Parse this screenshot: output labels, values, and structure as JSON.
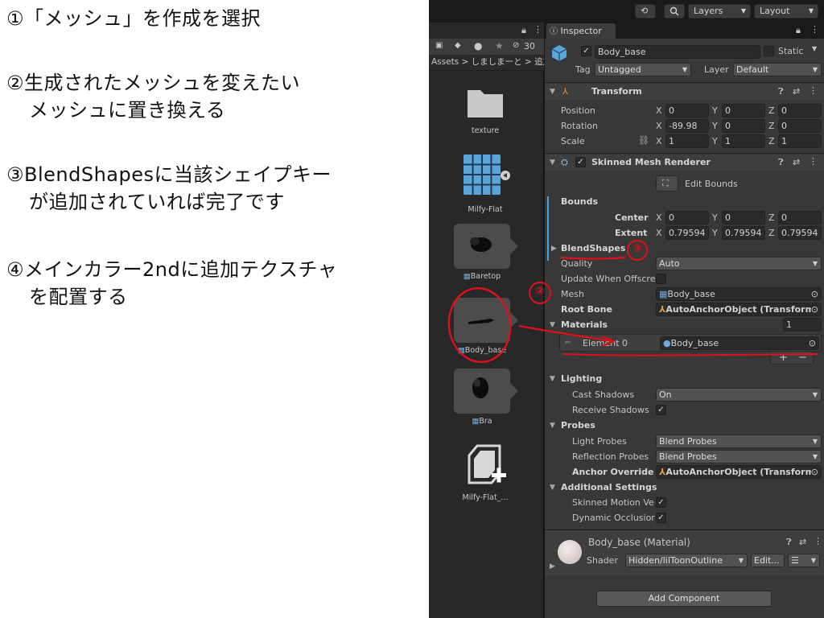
{
  "slide": {
    "steps": [
      {
        "line1": "①「メッシュ」を作成を選択",
        "line2": ""
      },
      {
        "line1": "②生成されたメッシュを変えたい",
        "line2": "メッシュに置き換える"
      },
      {
        "line1": "③BlendShapesに当該シェイプキー",
        "line2": "が追加されていれば完了です"
      },
      {
        "line1": "④メインカラー2ndに追加テクスチャ",
        "line2": "を配置する"
      }
    ]
  },
  "toolbar": {
    "history_icon": "history-icon",
    "search_icon": "search-icon",
    "layers_label": "Layers",
    "layout_label": "Layout"
  },
  "project": {
    "hidden_count": "30",
    "breadcrumb": "Assets > しましまーと > 追加",
    "assets": [
      {
        "label": "texture",
        "icon": "folder-icon"
      },
      {
        "label": "Milfy-Flat",
        "icon": "prefab-grid-icon"
      },
      {
        "label": "Baretop",
        "icon": "mesh-icon"
      },
      {
        "label": "Body_base",
        "icon": "mesh-icon"
      },
      {
        "label": "Bra",
        "icon": "mesh-icon"
      },
      {
        "label": "Milfy-Flat_...",
        "icon": "prefab-variant-icon"
      }
    ]
  },
  "inspector": {
    "tab_label": "Inspector",
    "object_name": "Body_base",
    "static_label": "Static",
    "tag_label": "Tag",
    "tag_value": "Untagged",
    "layer_label": "Layer",
    "layer_value": "Default",
    "transform": {
      "title": "Transform",
      "position_label": "Position",
      "rotation_label": "Rotation",
      "scale_label": "Scale",
      "position": {
        "x": "0",
        "y": "0",
        "z": "0"
      },
      "rotation": {
        "x": "-89.98",
        "y": "0",
        "z": "0"
      },
      "scale": {
        "x": "1",
        "y": "1",
        "z": "1"
      }
    },
    "smr": {
      "title": "Skinned Mesh Renderer",
      "edit_bounds": "Edit Bounds",
      "bounds_label": "Bounds",
      "center_label": "Center",
      "extent_label": "Extent",
      "center": {
        "x": "0",
        "y": "0",
        "z": "0"
      },
      "extent": {
        "x": "0.79594",
        "y": "0.79594",
        "z": "0.79594"
      },
      "blendshapes_label": "BlendShapes",
      "quality_label": "Quality",
      "quality_value": "Auto",
      "update_offscreen_label": "Update When Offscre",
      "mesh_label": "Mesh",
      "mesh_value": "Body_base",
      "root_bone_label": "Root Bone",
      "root_bone_value": "AutoAnchorObject (Transform",
      "materials_label": "Materials",
      "materials_count": "1",
      "element0_label": "Element 0",
      "element0_value": "Body_base",
      "lighting_label": "Lighting",
      "cast_shadows_label": "Cast Shadows",
      "cast_shadows_value": "On",
      "receive_shadows_label": "Receive Shadows",
      "probes_label": "Probes",
      "light_probes_label": "Light Probes",
      "light_probes_value": "Blend Probes",
      "reflection_probes_label": "Reflection Probes",
      "reflection_probes_value": "Blend Probes",
      "anchor_override_label": "Anchor Override",
      "anchor_override_value": "AutoAnchorObject (Transform",
      "additional_label": "Additional Settings",
      "skinned_motion_label": "Skinned Motion Ve",
      "dynamic_occlusion_label": "Dynamic Occlusior"
    },
    "material": {
      "title": "Body_base (Material)",
      "shader_label": "Shader",
      "shader_value": "Hidden/lilToonOutline",
      "edit_label": "Edit..."
    },
    "add_component": "Add Component"
  },
  "annotations": {
    "circle_labels": [
      "①",
      "②",
      "③"
    ],
    "color": "#e0101a"
  },
  "colors": {
    "panel_bg": "#383838",
    "header_bg": "#282828",
    "field_bg": "#2a2a2a",
    "accent_blue": "#4aa3df"
  }
}
